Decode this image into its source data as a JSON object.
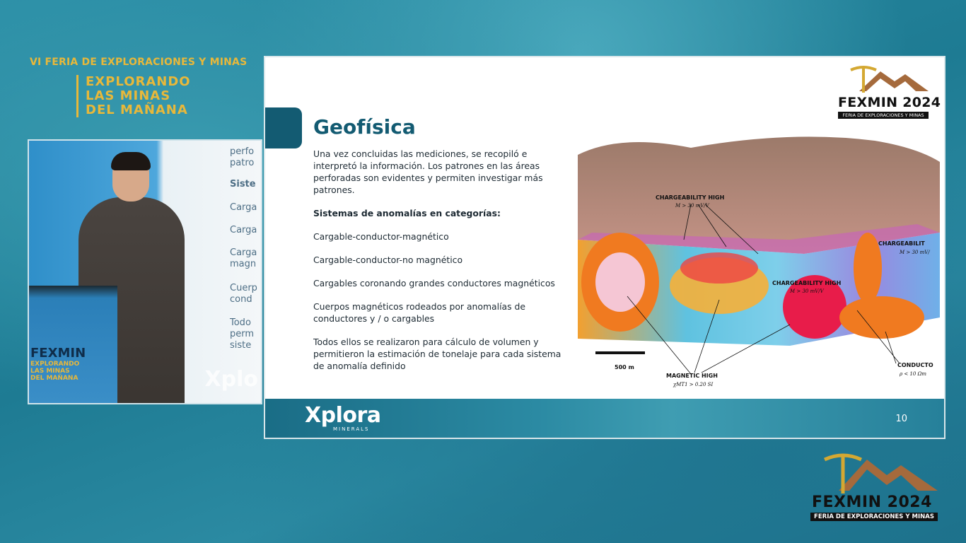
{
  "event": {
    "line1": "VI FERIA DE EXPLORACIONES Y MINAS",
    "sub": [
      "EXPLORANDO",
      "LAS MINAS",
      "DEL MAÑANA"
    ]
  },
  "speaker_feed": {
    "screen_text": [
      "perfo",
      "patro",
      "Siste",
      "Carga",
      "Carga",
      "Carga",
      "magn",
      "Cuerp",
      "cond",
      "Todo",
      "perm",
      "siste"
    ],
    "podium_logo": {
      "word": "FEXMIN",
      "sub": [
        "EXPLORANDO",
        "LAS MINAS",
        "DEL MAÑANA"
      ]
    },
    "watermark": "Xplo"
  },
  "slide": {
    "title": "Geofísica",
    "paragraphs": [
      "Una vez concluidas las mediciones, se recopiló e interpretó la información. Los patrones en las áreas perforadas son evidentes y permiten investigar más patrones.",
      "Sistemas de anomalías en categorías:",
      "Cargable-conductor-magnético",
      "Cargable-conductor-no magnético",
      "Cargables coronando grandes conductores magnéticos",
      "Cuerpos magnéticos rodeados por anomalías de conductores y / o cargables",
      "Todos ellos se realizaron para cálculo de volumen y permitieron la estimación de tonelaje para cada sistema de anomalía definido"
    ],
    "logo": {
      "word": "FEXMIN 2024",
      "sub": "FERIA DE EXPLORACIONES Y MINAS"
    },
    "map_labels": {
      "charge1": "CHARGEABILITY HIGH",
      "charge1_val": "M > 30 mV/V",
      "charge2": "CHARGEABILIT",
      "charge2_val": "M > 30 mV/",
      "charge3": "CHARGEABILITY HIGH",
      "charge3_val": "M > 30 mV/V",
      "magnetic": "MAGNETIC HIGH",
      "magnetic_val": "χMT1 > 0.20 SI",
      "conductor": "CONDUCTO",
      "conductor_val": "ρ < 10 Ωm",
      "scale": "500 m"
    },
    "footer": {
      "brand": "Xplora",
      "brand_sub": "MINERALS",
      "page": "10"
    }
  },
  "bug": {
    "word": "FEXMIN 2024",
    "sub": "FERIA DE EXPLORACIONES Y MINAS"
  },
  "colors": {
    "gold": "#e8b83a",
    "teal": "#135b72",
    "footer": "#2b8aa3"
  }
}
